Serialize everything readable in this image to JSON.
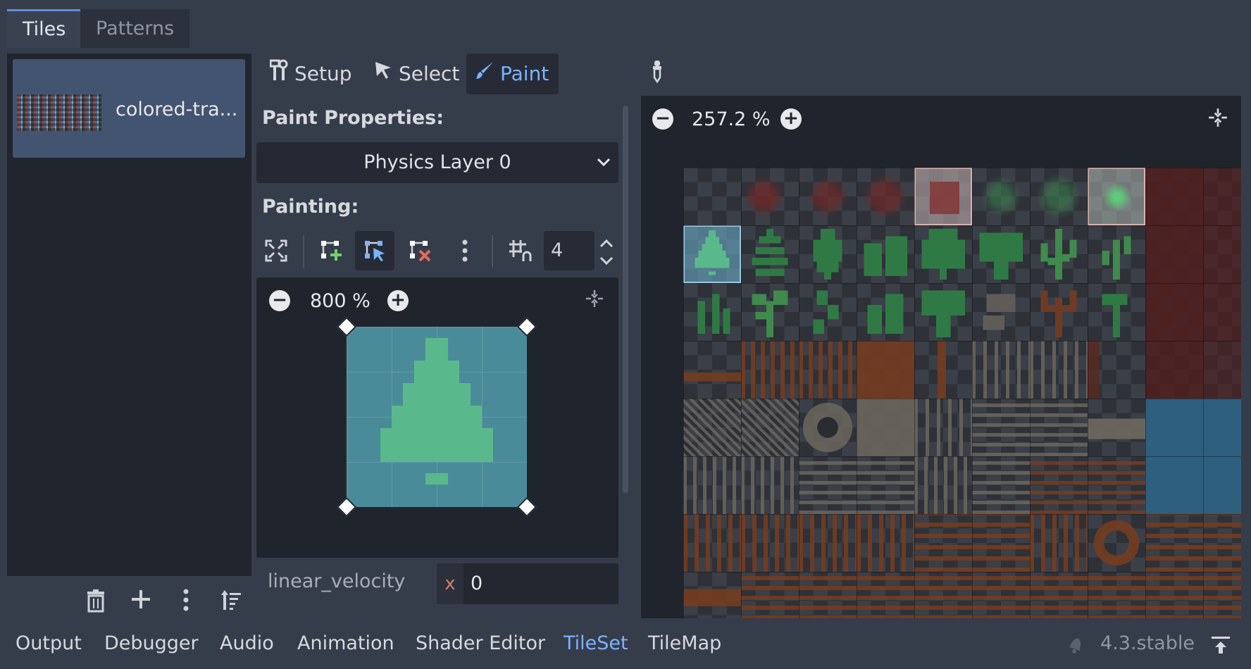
{
  "tabs": [
    {
      "label": "Tiles",
      "active": true
    },
    {
      "label": "Patterns",
      "active": false
    }
  ],
  "source": {
    "label": "colored-tra..."
  },
  "modes": [
    {
      "label": "Setup",
      "icon": "tools-icon",
      "active": false
    },
    {
      "label": "Select",
      "icon": "cursor-icon",
      "active": false
    },
    {
      "label": "Paint",
      "icon": "brush-icon",
      "active": true
    }
  ],
  "paint_properties": {
    "title": "Paint Properties:",
    "selected": "Physics Layer 0"
  },
  "painting": {
    "title": "Painting:",
    "value": "4"
  },
  "mini_editor": {
    "zoom": "800 %"
  },
  "inspector": {
    "label": "linear_velocity",
    "axis": "x",
    "value": "0"
  },
  "atlas": {
    "zoom": "257.2 %"
  },
  "bottom_tabs": [
    {
      "label": "Output"
    },
    {
      "label": "Debugger"
    },
    {
      "label": "Audio"
    },
    {
      "label": "Animation"
    },
    {
      "label": "Shader Editor"
    },
    {
      "label": "TileSet",
      "active": true
    },
    {
      "label": "TileMap"
    }
  ],
  "version": "4.3.stable",
  "colors": {
    "accent": "#7cb2ff",
    "panel": "#20242c",
    "tile_fill": "#4a8b99",
    "tree_green": "#59b98c"
  }
}
